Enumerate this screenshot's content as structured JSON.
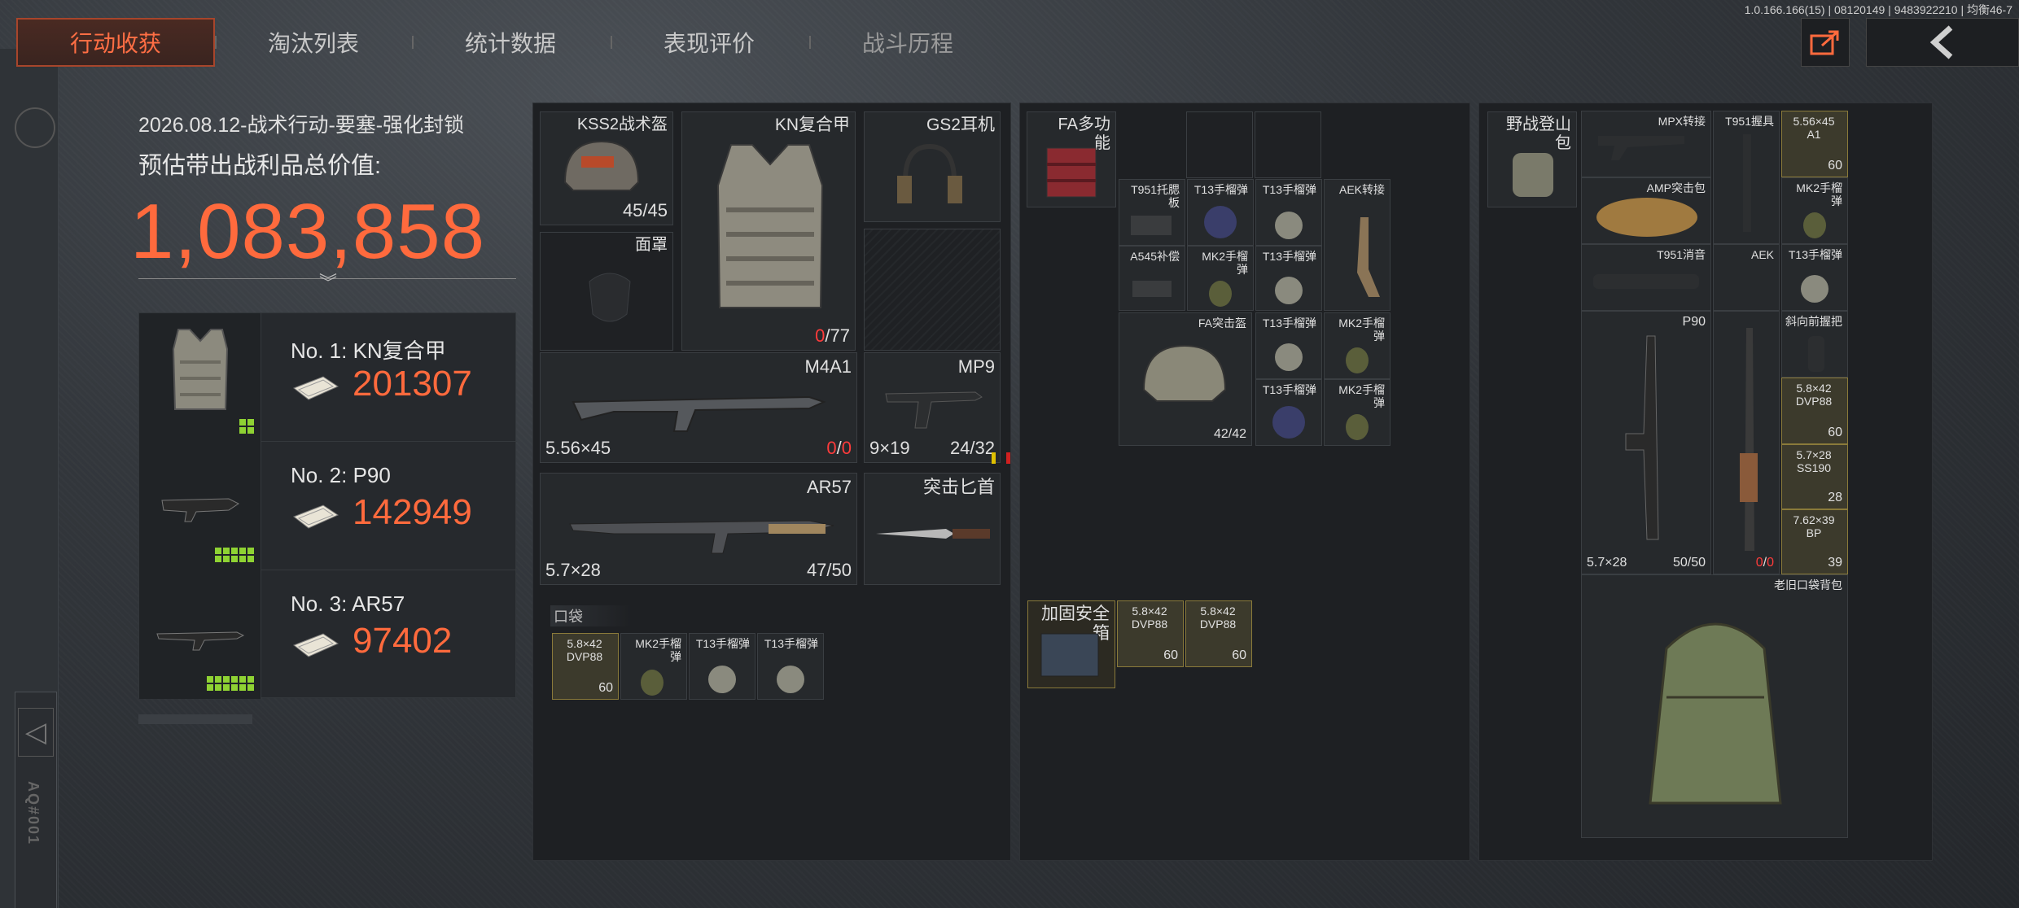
{
  "header": {
    "tabs": [
      {
        "label": "行动收获",
        "active": true
      },
      {
        "label": "淘汰列表",
        "active": false
      },
      {
        "label": "统计数据",
        "active": false
      },
      {
        "label": "表现评价",
        "active": false
      },
      {
        "label": "战斗历程",
        "active": false
      }
    ],
    "version": "1.0.166.166(15) | 08120149 | 9483922210 | 均衡46-7"
  },
  "sidebar": {
    "code": "AQ#001"
  },
  "summary": {
    "date_mode": "2026.08.12-战术行动-要塞-强化封锁",
    "label": "预估带出战利品总价值:",
    "value": "1,083,858"
  },
  "top_items": [
    {
      "rank": "No. 1: KN复合甲",
      "value": "201307",
      "rarity_cells": 4
    },
    {
      "rank": "No. 2: P90",
      "value": "142949",
      "rarity_cells": 5
    },
    {
      "rank": "No. 3: AR57",
      "value": "97402",
      "rarity_cells": 8
    }
  ],
  "equipment": {
    "helmet": {
      "name": "KSS2战术盔",
      "durability": "45/45"
    },
    "armor": {
      "name": "KN复合甲",
      "durability_cur": "0",
      "durability_max": "/77"
    },
    "headset": {
      "name": "GS2耳机"
    },
    "mask": {
      "name": "面罩"
    },
    "primary": {
      "name": "M4A1",
      "caliber": "5.56×45",
      "ammo_cur": "0",
      "ammo_sep": "/",
      "ammo_max": "0"
    },
    "secondary": {
      "name": "MP9",
      "caliber": "9×19",
      "ammo": "24/32"
    },
    "primary2": {
      "name": "AR57",
      "caliber": "5.7×28",
      "ammo": "47/50"
    },
    "melee": {
      "name": "突击匕首"
    },
    "pocket_label": "口袋",
    "pocket": [
      {
        "name": "5.8×42 DVP88",
        "count": "60"
      },
      {
        "name": "MK2手榴弹"
      },
      {
        "name": "T13手榴弹"
      },
      {
        "name": "T13手榴弹"
      }
    ]
  },
  "rig": {
    "name": "FA多功能",
    "items": [
      {
        "name": "T951托腮板"
      },
      {
        "name": "T13手榴弹"
      },
      {
        "name": "T13手榴弹"
      },
      {
        "name": "AEK转接"
      },
      {
        "name": "A545补偿"
      },
      {
        "name": "MK2手榴弹"
      },
      {
        "name": "T13手榴弹"
      },
      {
        "name": "FA突击盔",
        "durability": "42/42"
      },
      {
        "name": "T13手榴弹"
      },
      {
        "name": "MK2手榴弹"
      },
      {
        "name": "T13手榴弹"
      },
      {
        "name": "MK2手榴弹"
      }
    ],
    "safebox": {
      "name": "加固安全箱"
    },
    "safebox_items": [
      {
        "name": "5.8×42 DVP88",
        "count": "60"
      },
      {
        "name": "5.8×42 DVP88",
        "count": "60"
      }
    ]
  },
  "backpack": {
    "name": "野战登山包",
    "items": {
      "mpx": "MPX转接",
      "t951stock": "T951握具",
      "ammo556": {
        "name": "5.56×45 A1",
        "count": "60"
      },
      "amp": "AMP突击包",
      "mk2a": "MK2手榴弹",
      "t951sup": "T951消音",
      "aek": "AEK",
      "t13": "T13手榴弹",
      "p90": {
        "name": "P90",
        "caliber": "5.7×28",
        "ammo": "50/50"
      },
      "grip": "斜向前握把",
      "ammo58": {
        "name": "5.8×42 DVP88",
        "count": "60"
      },
      "ammo57": {
        "name": "5.7×28 SS190",
        "count": "28"
      },
      "ammo762": {
        "name": "7.62×39 BP",
        "count": "39"
      },
      "aek_ammo": {
        "cur": "0",
        "sep": "/",
        "max": "0"
      },
      "oldbag": "老旧口袋背包"
    }
  }
}
